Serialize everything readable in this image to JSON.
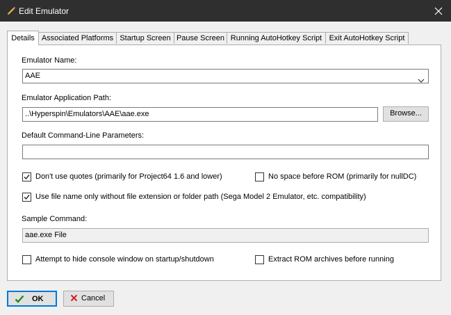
{
  "window": {
    "title": "Edit Emulator"
  },
  "tabs": [
    {
      "label": "Details"
    },
    {
      "label": "Associated Platforms"
    },
    {
      "label": "Startup Screen"
    },
    {
      "label": "Pause Screen"
    },
    {
      "label": "Running AutoHotkey Script"
    },
    {
      "label": "Exit AutoHotkey Script"
    }
  ],
  "details": {
    "emulator_name_label": "Emulator Name:",
    "emulator_name_value": "AAE",
    "app_path_label": "Emulator Application Path:",
    "app_path_value": "..\\Hyperspin\\Emulators\\AAE\\aae.exe",
    "browse_label": "Browse...",
    "params_label": "Default Command-Line Parameters:",
    "params_value": "",
    "no_quotes_label": "Don't use quotes (primarily for Project64 1.6 and lower)",
    "no_quotes_checked": true,
    "no_space_label": "No space before ROM (primarily for nullDC)",
    "no_space_checked": false,
    "filename_only_label": "Use file name only without file extension or folder path (Sega Model 2 Emulator, etc. compatibility)",
    "filename_only_checked": true,
    "sample_label": "Sample Command:",
    "sample_value": "aae.exe File",
    "hide_console_label": "Attempt to hide console window on startup/shutdown",
    "hide_console_checked": false,
    "extract_rom_label": "Extract ROM archives before running",
    "extract_rom_checked": false
  },
  "footer": {
    "ok_label": "OK",
    "cancel_label": "Cancel"
  },
  "colors": {
    "titlebar": "#2f2f2f",
    "focus_border": "#0078d7",
    "ok_check": "#1e8c1e",
    "cancel_x": "#d22020"
  },
  "icons": {
    "app": "pencil-icon",
    "close": "close-icon",
    "ok": "checkmark-icon",
    "cancel": "cancel-x-icon"
  }
}
